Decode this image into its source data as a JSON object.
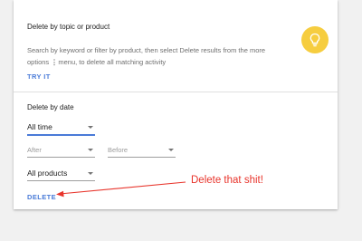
{
  "topic_section": {
    "title": "Delete by topic or product",
    "description_before": "Search by keyword or filter by product, then select Delete results from the more options",
    "kebab_glyph": "⋮",
    "description_after": "menu, to delete all matching activity",
    "try_it_label": "TRY IT",
    "icon": "lightbulb-icon"
  },
  "date_section": {
    "title": "Delete by date",
    "range_value": "All time",
    "after_placeholder": "After",
    "before_placeholder": "Before",
    "product_value": "All products",
    "delete_label": "DELETE"
  },
  "annotation": {
    "text": "Delete that shit!"
  },
  "colors": {
    "accent": "#4a7bd8",
    "bulb": "#f6cd3f",
    "annotation": "#e8342b"
  }
}
